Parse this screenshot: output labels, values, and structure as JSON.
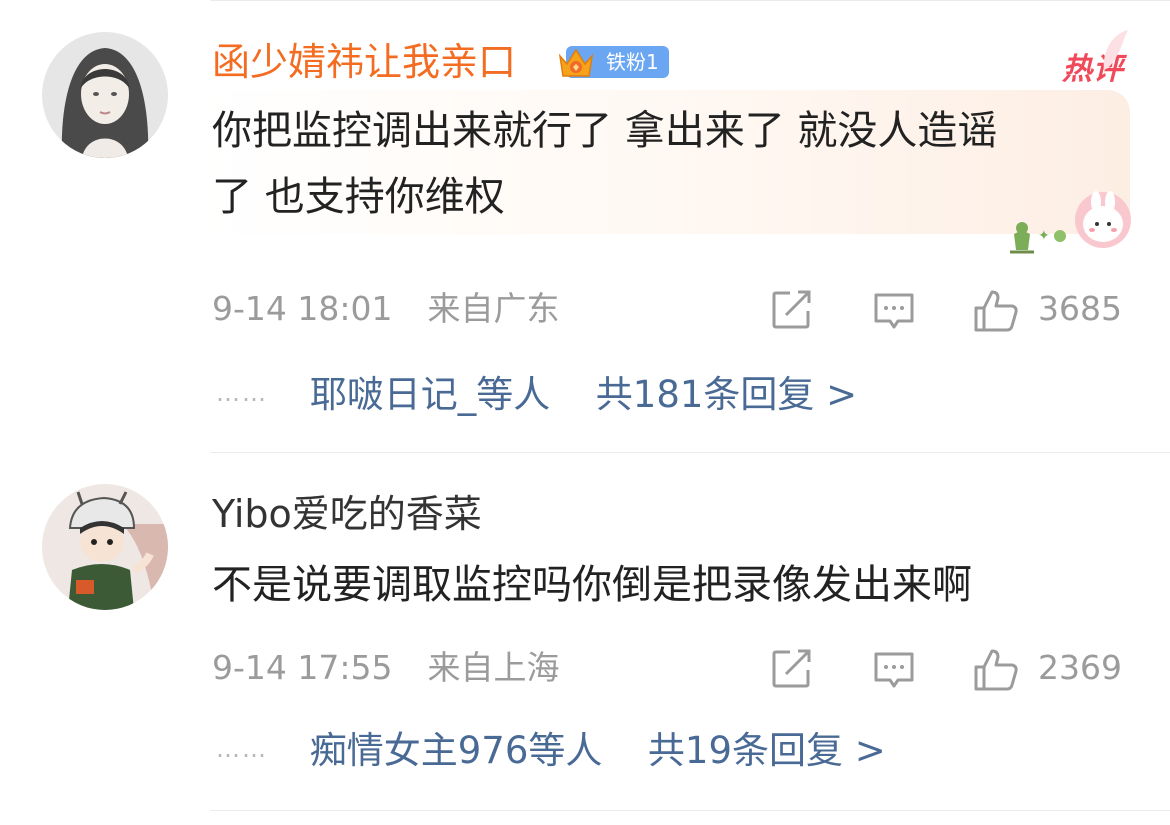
{
  "comments": [
    {
      "username": "函少婧祎让我亲口",
      "badge_label": "铁粉1",
      "hot_tag": "热评",
      "text_line1": "你把监控调出来就行了 拿出来了  就没人造谣",
      "text_line2": "了  也支持你维权",
      "timestamp": "9-14 18:01",
      "location": "来自广东",
      "like_count": "3685",
      "reply_users": "耶啵日记_等人",
      "reply_count": "共181条回复 >",
      "colors": {
        "username": "#f36c21"
      }
    },
    {
      "username": "Yibo爱吃的香菜",
      "text_line1": "不是说要调取监控吗你倒是把录像发出来啊",
      "timestamp": "9-14 17:55",
      "location": "来自上海",
      "like_count": "2369",
      "reply_users": "痴情女主976等人",
      "reply_count": "共19条回复 >",
      "colors": {
        "username": "#333333"
      }
    }
  ],
  "icons": {
    "repost": "repost-icon",
    "comment": "comment-icon",
    "like": "like-icon",
    "crown": "crown-icon",
    "sticker": "bunny-sticker-icon"
  },
  "ellipsis": "……"
}
